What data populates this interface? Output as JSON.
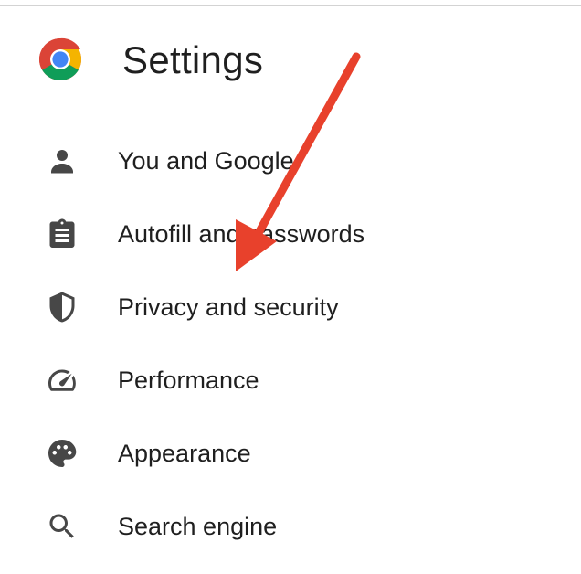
{
  "header": {
    "title": "Settings",
    "logo": "chrome-logo"
  },
  "menu": {
    "items": [
      {
        "label": "You and Google",
        "icon": "person-icon"
      },
      {
        "label": "Autofill and passwords",
        "icon": "clipboard-icon"
      },
      {
        "label": "Privacy and security",
        "icon": "shield-icon"
      },
      {
        "label": "Performance",
        "icon": "speedometer-icon"
      },
      {
        "label": "Appearance",
        "icon": "palette-icon"
      },
      {
        "label": "Search engine",
        "icon": "search-icon"
      }
    ]
  },
  "annotation": {
    "arrow_color": "#e8412c"
  },
  "colors": {
    "text": "#1f1f1f",
    "icon": "#474747",
    "divider": "#d3d3d3"
  }
}
